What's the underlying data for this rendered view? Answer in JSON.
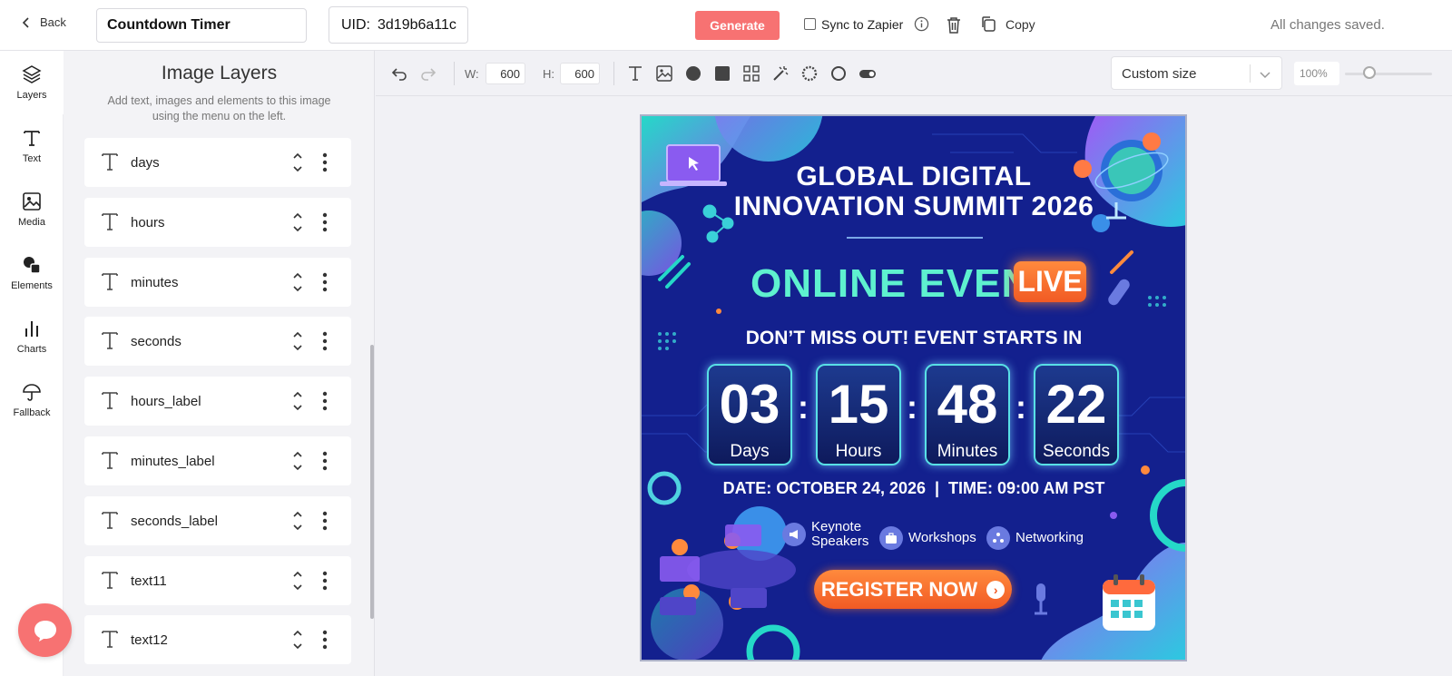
{
  "topbar": {
    "back_label": "Back",
    "title_value": "Countdown Timer",
    "uid_label": "UID:",
    "uid_value": "3d19b6a11c",
    "generate_label": "Generate",
    "sync_label": "Sync to Zapier",
    "copy_label": "Copy",
    "status": "All changes saved."
  },
  "rail": {
    "items": [
      {
        "label": "Layers",
        "icon": "layers-icon"
      },
      {
        "label": "Text",
        "icon": "text-icon"
      },
      {
        "label": "Media",
        "icon": "image-icon"
      },
      {
        "label": "Elements",
        "icon": "shapes-icon"
      },
      {
        "label": "Charts",
        "icon": "bar-chart-icon"
      },
      {
        "label": "Fallback",
        "icon": "umbrella-icon"
      }
    ]
  },
  "panel": {
    "title": "Image Layers",
    "subtitle": "Add text, images and elements to this image using the menu on the left.",
    "layers": [
      {
        "name": "days"
      },
      {
        "name": "hours"
      },
      {
        "name": "minutes"
      },
      {
        "name": "seconds"
      },
      {
        "name": "hours_label"
      },
      {
        "name": "minutes_label"
      },
      {
        "name": "seconds_label"
      },
      {
        "name": "text11"
      },
      {
        "name": "text12"
      }
    ]
  },
  "toolbar": {
    "width_label": "W:",
    "width_value": "600",
    "height_label": "H:",
    "height_value": "600",
    "size_preset": "Custom size",
    "zoom": "100%",
    "zoom_fraction": 0.28
  },
  "design": {
    "title_line1": "GLOBAL DIGITAL",
    "title_line2": "INNOVATION SUMMIT 2026",
    "event": "ONLINE EVENT",
    "live": "LIVE",
    "starts": "DON’T MISS OUT! EVENT STARTS IN",
    "countdown": [
      {
        "value": "03",
        "label": "Days"
      },
      {
        "value": "15",
        "label": "Hours"
      },
      {
        "value": "48",
        "label": "Minutes"
      },
      {
        "value": "22",
        "label": "Seconds"
      }
    ],
    "date_line": "DATE: OCTOBER 24, 2026  |  TIME: 09:00 AM PST",
    "features": [
      {
        "label_line1": "Keynote",
        "label_line2": "Speakers"
      },
      {
        "label_line1": "Workshops",
        "label_line2": ""
      },
      {
        "label_line1": "Networking",
        "label_line2": ""
      }
    ],
    "register": "REGISTER NOW"
  },
  "colors": {
    "accent": "#f77272",
    "canvas_bg": "#13208e",
    "event_text": "#5ef1cf",
    "cta_orange": "#f15a24"
  }
}
